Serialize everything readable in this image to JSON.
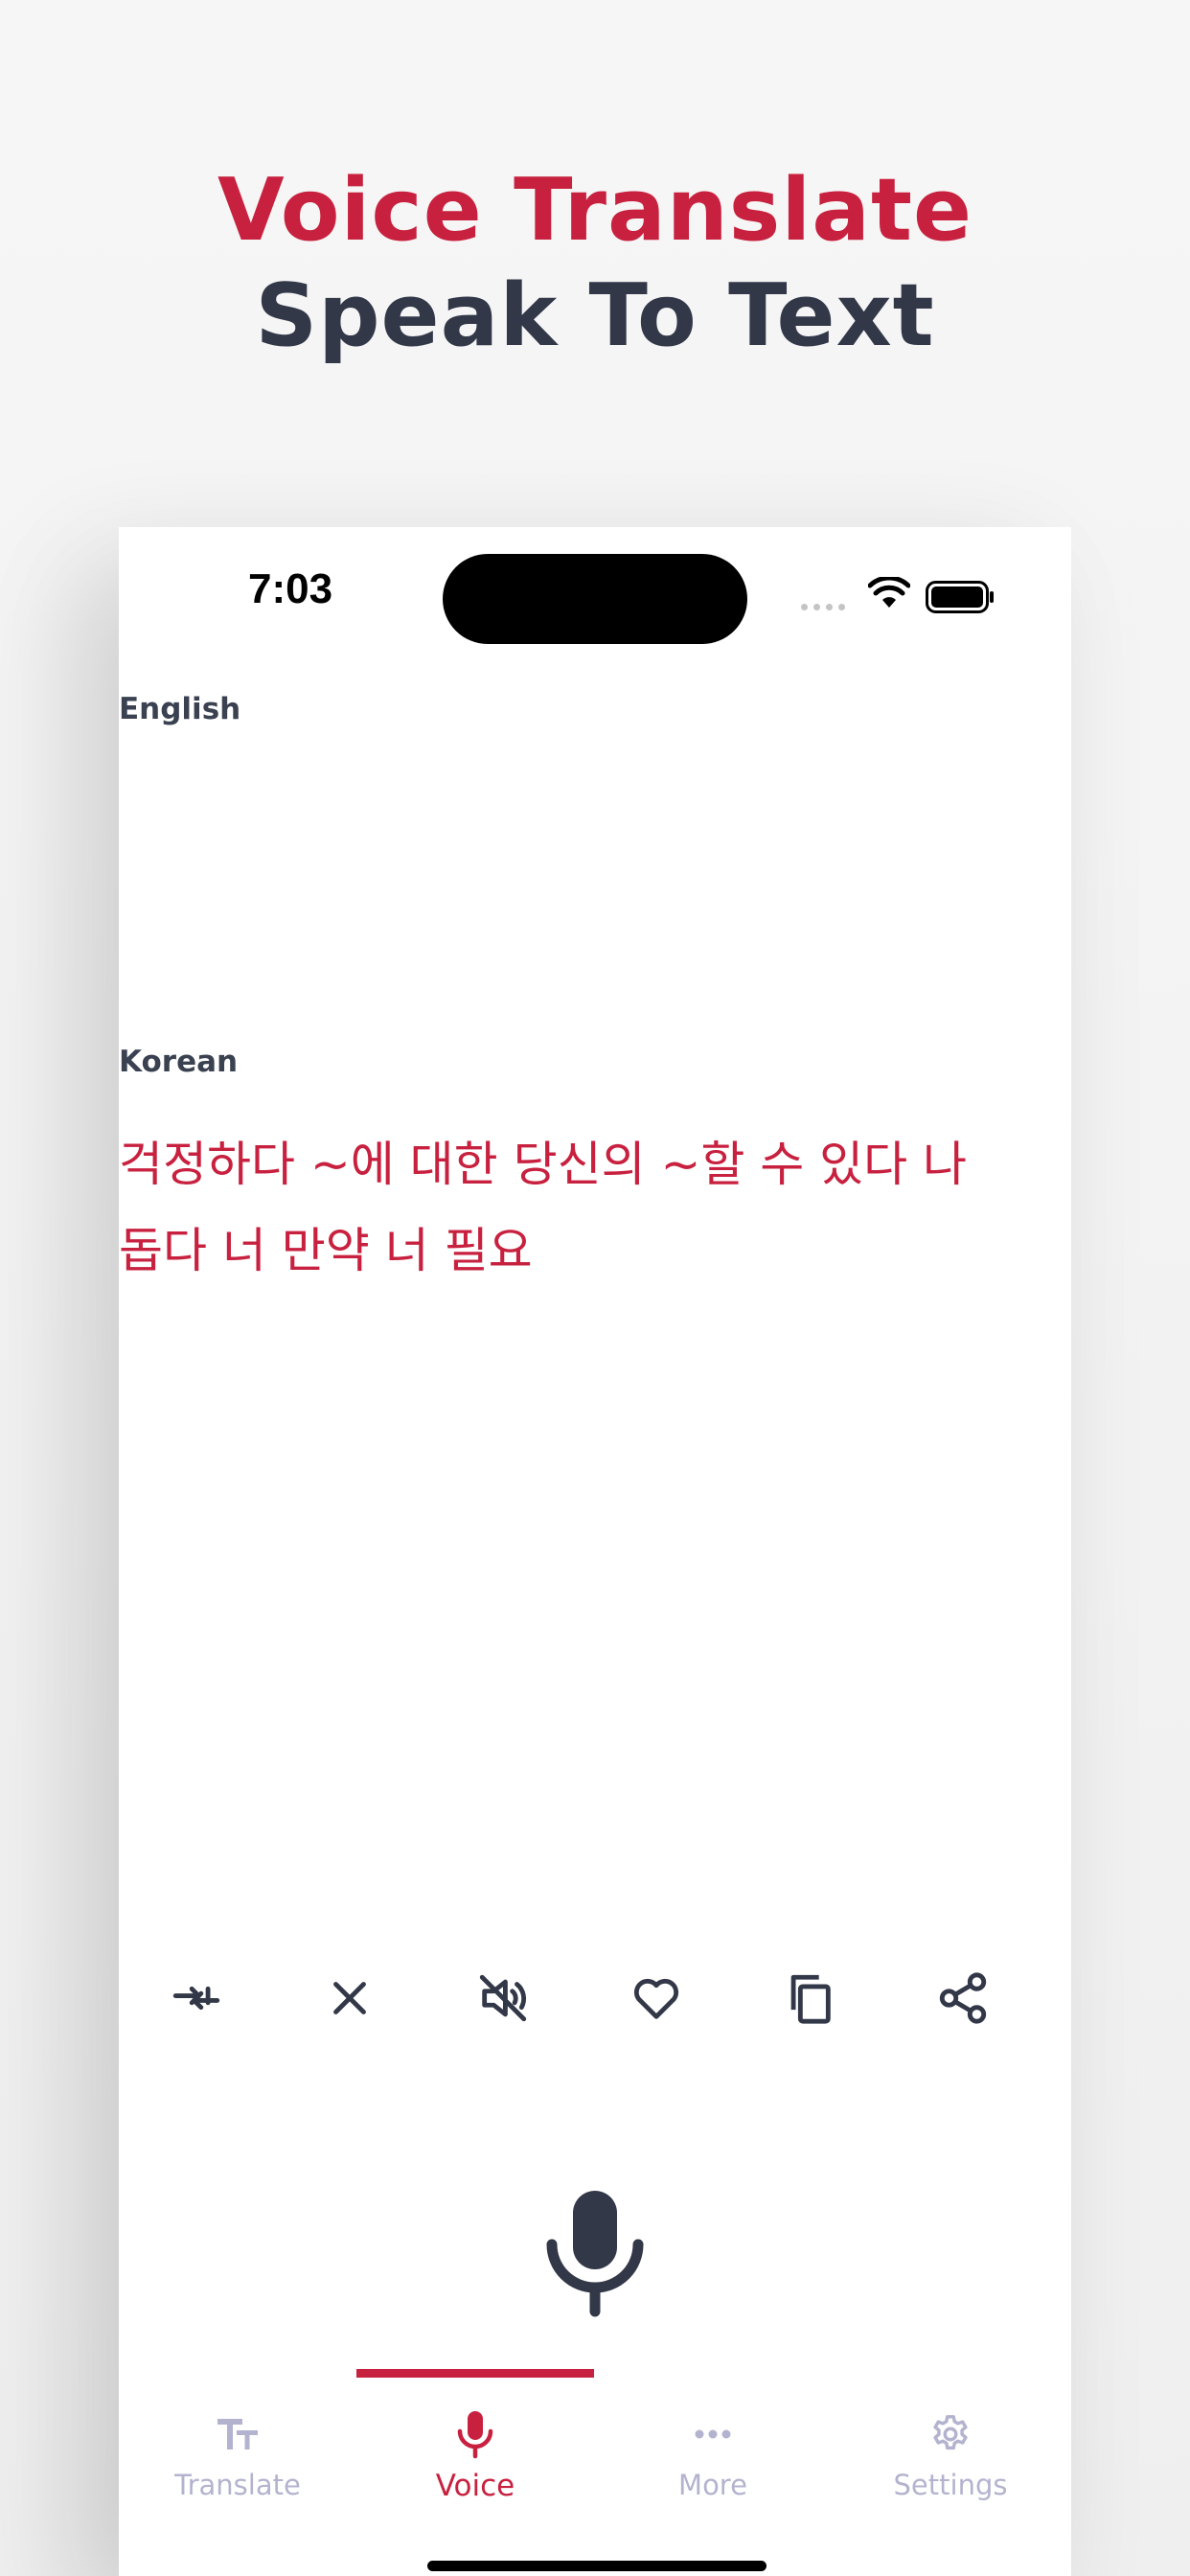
{
  "promo": {
    "title_line1": "Voice Translate",
    "title_line2": "Speak To Text"
  },
  "status_bar": {
    "time": "7:03"
  },
  "translation": {
    "source_language": "English",
    "source_text": "",
    "target_language": "Korean",
    "target_text": "걱정하다 ~에 대한 당신의  ~할 수 있다 나 돕다 너 만약 너 필요"
  },
  "actions": [
    "swap-icon",
    "clear-icon",
    "mute-icon",
    "heart-icon",
    "copy-icon",
    "share-icon"
  ],
  "tabs": [
    {
      "label": "Translate",
      "icon": "text-size-icon",
      "active": false
    },
    {
      "label": "Voice",
      "icon": "mic-icon",
      "active": true
    },
    {
      "label": "More",
      "icon": "more-dots-icon",
      "active": false
    },
    {
      "label": "Settings",
      "icon": "gear-icon",
      "active": false
    }
  ],
  "colors": {
    "accent": "#c8213f",
    "dark": "#323848",
    "inactive": "#b4b3cf"
  }
}
